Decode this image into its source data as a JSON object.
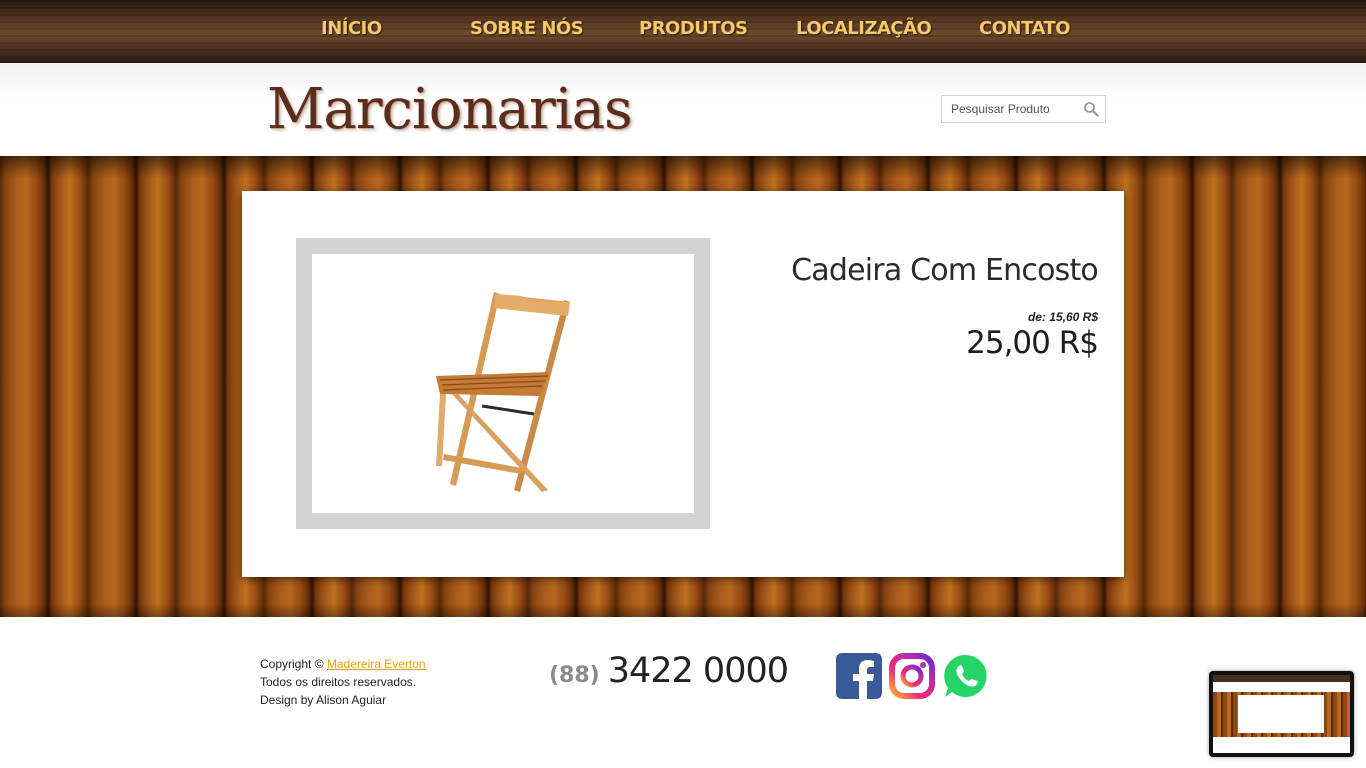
{
  "nav": {
    "items": [
      {
        "label": "INÍCIO"
      },
      {
        "label": "SOBRE NÓS"
      },
      {
        "label": "PRODUTOS"
      },
      {
        "label": "LOCALIZAÇÃO"
      },
      {
        "label": "CONTATO"
      }
    ]
  },
  "header": {
    "logo_text": "Marcionarias",
    "search_placeholder": "Pesquisar Produto"
  },
  "product": {
    "title": "Cadeira Com Encosto",
    "old_price": "de: 15,60 R$",
    "price": "25,00 R$",
    "image_alt": "chair-photo"
  },
  "footer": {
    "copyright_prefix": "Copyright ©",
    "company_link": "Madereira Everton",
    "rights": "Todos os direitos reservados.",
    "design": "Design by Alison Aguiar",
    "phone_ddd": "(88)",
    "phone_number": "3422 0000"
  },
  "colors": {
    "nav_text": "#f5c86a",
    "link": "#e8a200",
    "logo": "#5a2d1c",
    "facebook": "#3b5998",
    "whatsapp": "#25d366"
  }
}
